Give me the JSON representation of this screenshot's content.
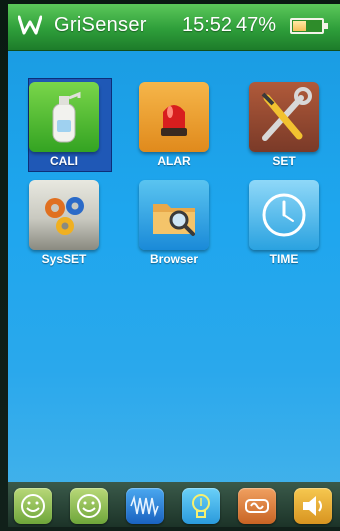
{
  "status_bar": {
    "title": "GriSenser",
    "time": "15:52",
    "battery_percent": "47%",
    "battery_level": 0.47
  },
  "apps": [
    {
      "label": "CALI",
      "icon": "gas-cylinder-icon",
      "selected": true
    },
    {
      "label": "ALAR",
      "icon": "alarm-beacon-icon"
    },
    {
      "label": "SET",
      "icon": "tools-icon"
    },
    {
      "label": "SysSET",
      "icon": "gears-icon"
    },
    {
      "label": "Browser",
      "icon": "folder-search-icon"
    },
    {
      "label": "TIME",
      "icon": "clock-icon"
    }
  ],
  "dock": [
    {
      "icon": "smiley-icon"
    },
    {
      "icon": "smiley-icon"
    },
    {
      "icon": "waveform-icon"
    },
    {
      "icon": "lightbulb-icon"
    },
    {
      "icon": "signal-icon"
    },
    {
      "icon": "speaker-icon"
    }
  ],
  "colors": {
    "status_bar": "#2e9e3a",
    "screen_bg": "#1ea6ee",
    "selection": "#1f58b6"
  }
}
